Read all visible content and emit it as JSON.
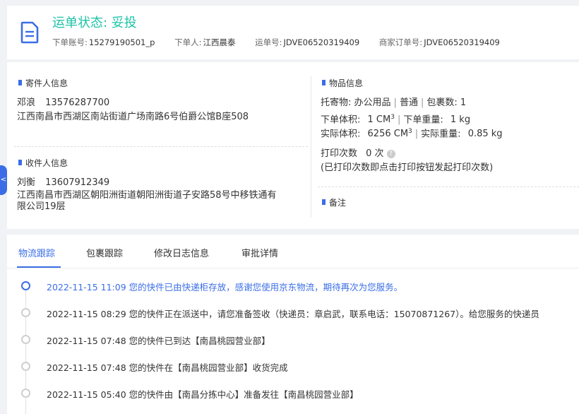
{
  "header": {
    "status_title": "运单状态: 妥投",
    "order_account_label": "下单账号:",
    "order_account": "15279190501_p",
    "orderer_label": "下单人:",
    "orderer": "江西晨泰",
    "waybill_label": "运单号:",
    "waybill": "JDVE06520319409",
    "merchant_order_label": "商家订单号:",
    "merchant_order": "JDVE06520319409"
  },
  "sender": {
    "title": "寄件人信息",
    "name": "邓浪",
    "phone": "13576287700",
    "address": "江西南昌市西湖区南站街道广场南路6号伯爵公馆B座508"
  },
  "receiver": {
    "title": "收件人信息",
    "name": "刘衡",
    "phone": "13607912349",
    "address_line1": "江西南昌市西湖区朝阳洲街道朝阳洲街道子安路58号中移铁通有",
    "address_line2": "限公司19层"
  },
  "goods": {
    "title": "物品信息",
    "consignment_label": "托寄物:",
    "consignment": "办公用品",
    "service": "普通",
    "package_count_label": "包裹数:",
    "package_count": "1",
    "order_volume_label": "下单体积:",
    "order_volume": "1 CM",
    "order_weight_label": "下单重量:",
    "order_weight": "1 kg",
    "actual_volume_label": "实际体积:",
    "actual_volume": "6256 CM",
    "actual_weight_label": "实际重量:",
    "actual_weight": "0.85 kg",
    "cube_sup": "3",
    "print_count_label": "打印次数",
    "print_count": "0 次",
    "print_note": "(已打印次数即点击打印按钮发起打印次数)"
  },
  "remark": {
    "title": "备注"
  },
  "side_tab": {
    "glyph": "<"
  },
  "tabs": [
    {
      "label": "物流跟踪"
    },
    {
      "label": "包裹跟踪"
    },
    {
      "label": "修改日志信息"
    },
    {
      "label": "审批详情"
    }
  ],
  "timeline": [
    {
      "time": "2022-11-15 11:09",
      "text": "您的快件已由快递柜存放，感谢您使用京东物流，期待再次为您服务。"
    },
    {
      "time": "2022-11-15 08:29",
      "text": "您的快件正在派送中，请您准备签收（快递员：章启武，联系电话：15070871267）。给您服务的快递员"
    },
    {
      "time": "2022-11-15 07:48",
      "text": "您的快件已到达【南昌桃园营业部】"
    },
    {
      "time": "2022-11-15 07:48",
      "text": "您的快件在【南昌桃园营业部】收货完成"
    },
    {
      "time": "2022-11-15 05:40",
      "text": "您的快件由【南昌分拣中心】准备发往【南昌桃园营业部】"
    }
  ],
  "colors": {
    "accent": "#3b6ee6",
    "status_green": "#1ec3a7"
  }
}
